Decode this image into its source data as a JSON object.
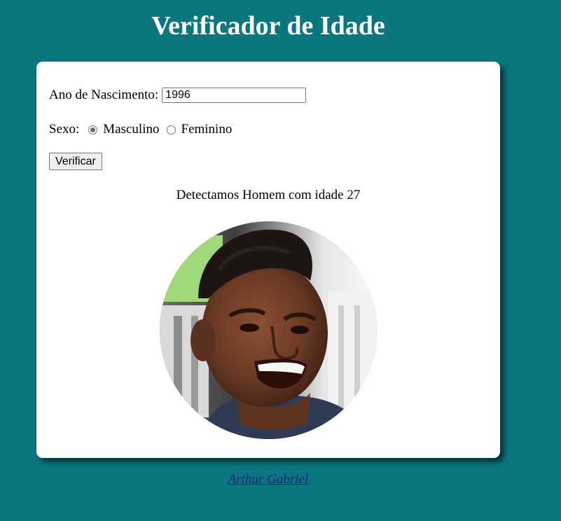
{
  "header": {
    "title": "Verificador de Idade"
  },
  "form": {
    "year_label": "Ano de Nascimento:",
    "year_value": "1996",
    "sex_label": "Sexo:",
    "options": [
      {
        "label": "Masculino",
        "checked": true
      },
      {
        "label": "Feminino",
        "checked": false
      }
    ],
    "submit_label": "Verificar"
  },
  "result": {
    "text": "Detectamos Homem com idade 27",
    "image_alt": "photo-of-smiling-young-man"
  },
  "footer": {
    "author_link": "Arthur Gabriel"
  },
  "colors": {
    "background": "#0a767e",
    "card": "#ffffff",
    "title": "#ffffff",
    "link": "#1a1a8c"
  }
}
